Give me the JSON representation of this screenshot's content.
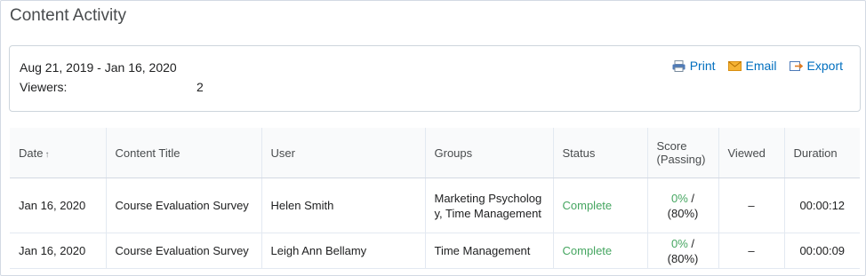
{
  "page": {
    "title": "Content Activity"
  },
  "summary": {
    "date_range": "Aug 21, 2019 - Jan 16, 2020",
    "viewers_label": "Viewers:",
    "viewers_count": "2"
  },
  "actions": {
    "print_label": "Print",
    "email_label": "Email",
    "export_label": "Export"
  },
  "colors": {
    "link": "#006fbf",
    "complete": "#46a661"
  },
  "table": {
    "headers": {
      "date": "Date",
      "date_sort": "↑",
      "content_title": "Content Title",
      "user": "User",
      "groups": "Groups",
      "status": "Status",
      "score_line1": "Score",
      "score_line2": "(Passing)",
      "viewed": "Viewed",
      "duration": "Duration"
    },
    "rows": [
      {
        "date": "Jan 16, 2020",
        "content_title": "Course Evaluation Survey",
        "user": "Helen Smith",
        "groups": "Marketing Psychology, Time Management",
        "status": "Complete",
        "score": "0%",
        "passing": " / (80%)",
        "viewed": "–",
        "duration": "00:00:12"
      },
      {
        "date": "Jan 16, 2020",
        "content_title": "Course Evaluation Survey",
        "user": "Leigh Ann Bellamy",
        "groups": "Time Management",
        "status": "Complete",
        "score": "0%",
        "passing": " / (80%)",
        "viewed": "–",
        "duration": "00:00:09"
      }
    ]
  }
}
